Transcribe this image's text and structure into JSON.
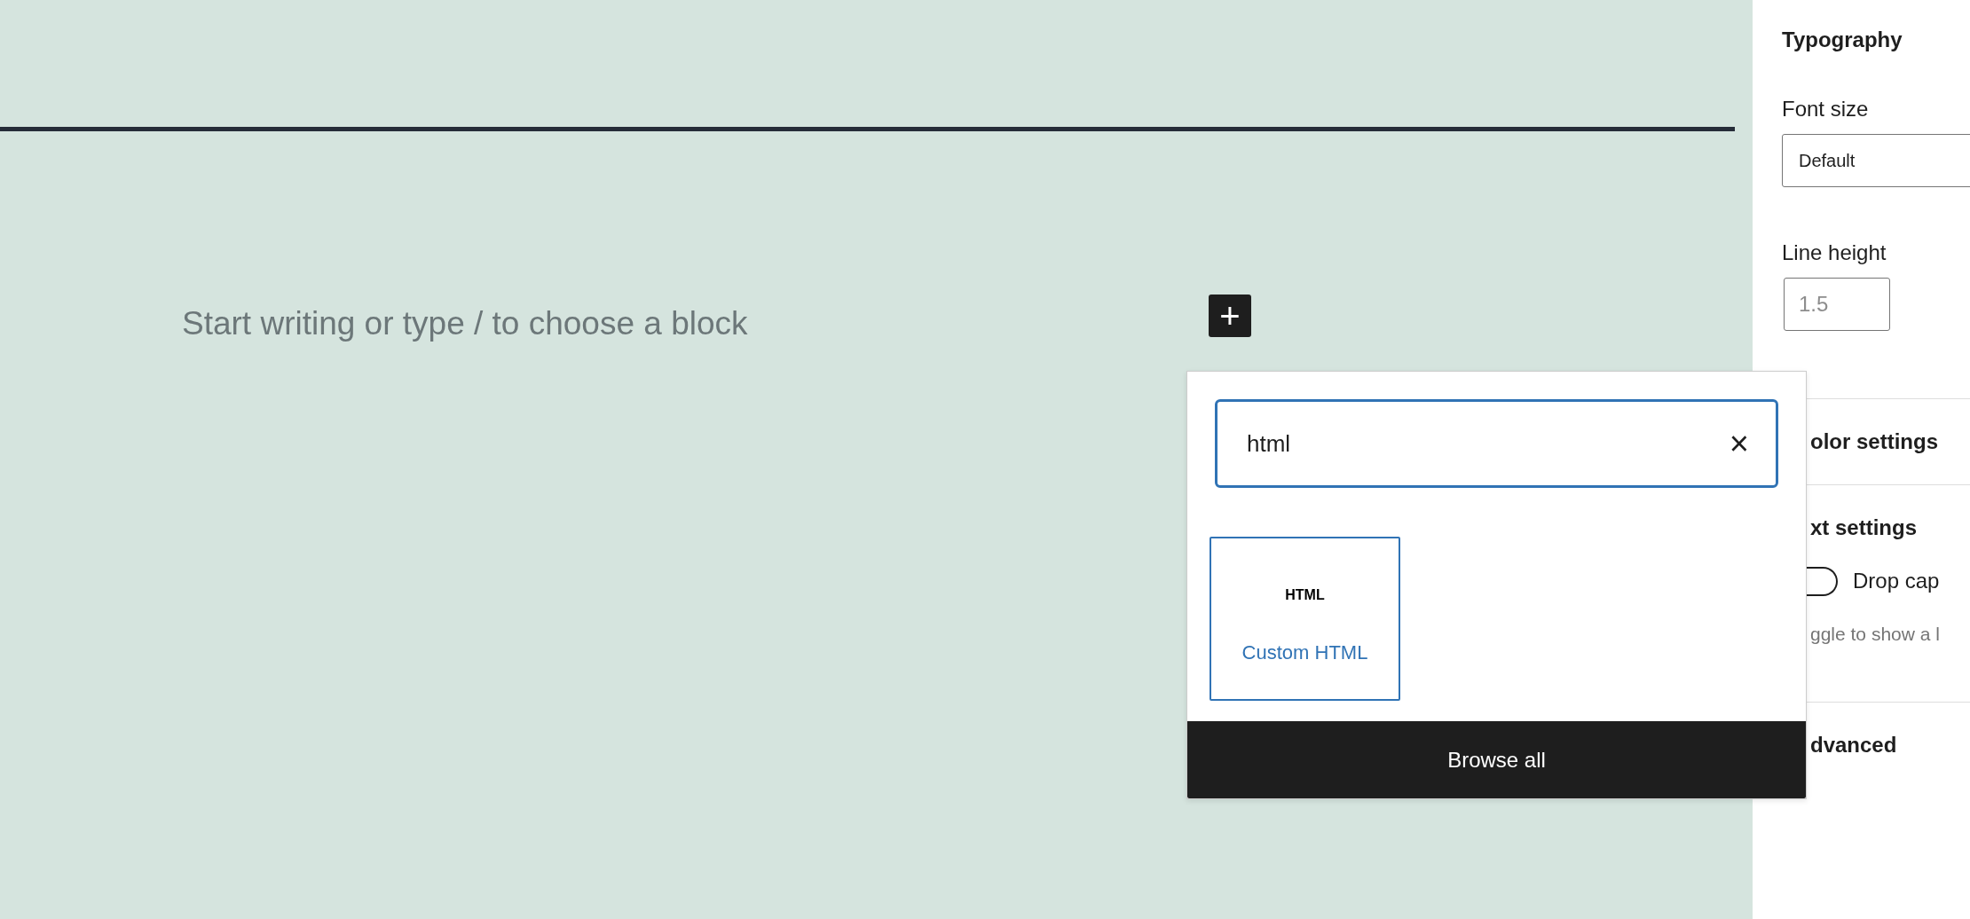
{
  "editor": {
    "placeholder": "Start writing or type / to choose a block",
    "inserter_button": "+"
  },
  "inserter_popup": {
    "search": {
      "value": "html",
      "clear": "×"
    },
    "blocks": [
      {
        "icon_text": "HTML",
        "label": "Custom HTML",
        "selected": true
      }
    ],
    "browse_all": "Browse all"
  },
  "sidebar": {
    "title": "Typography",
    "font_size": {
      "label": "Font size",
      "value": "Default"
    },
    "line_height": {
      "label": "Line height",
      "placeholder": "1.5"
    },
    "sections": [
      {
        "kind": "heading",
        "title": "olor settings"
      },
      {
        "kind": "toggle",
        "title": "xt settings",
        "toggle_label": "Drop cap",
        "checked": false,
        "help": "ggle to show a l"
      },
      {
        "kind": "heading",
        "title": "dvanced"
      }
    ]
  }
}
